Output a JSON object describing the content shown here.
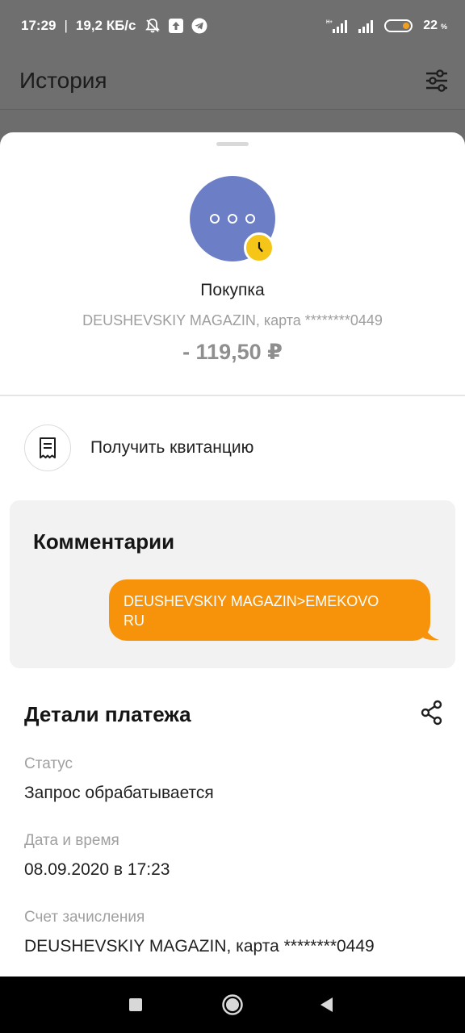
{
  "status_bar": {
    "time": "17:29",
    "separator": "|",
    "speed": "19,2 КБ/с",
    "battery_level": "22",
    "battery_unit": "%",
    "icons": [
      "bell-off-icon",
      "upload-icon",
      "telegram-icon",
      "signal-icon",
      "signal-icon",
      "battery-icon"
    ]
  },
  "header": {
    "title": "История",
    "filter_icon": "sliders-icon"
  },
  "transaction": {
    "avatar_icon": "more-dots-icon",
    "status_badge_icon": "clock-icon",
    "type": "Покупка",
    "merchant": "DEUSHEVSKIY MAGAZIN, карта ********0449",
    "amount": "- 119,50 ₽"
  },
  "receipt": {
    "icon": "receipt-icon",
    "label": "Получить квитанцию"
  },
  "comments": {
    "title": "Комментарии",
    "message_line1": "DEUSHEVSKIY MAGAZIN>EMEKOVO",
    "message_line2": "RU"
  },
  "details": {
    "title": "Детали платежа",
    "share_icon": "share-icon",
    "fields": [
      {
        "label": "Статус",
        "value": "Запрос обрабатывается"
      },
      {
        "label": "Дата и время",
        "value": "08.09.2020 в 17:23"
      },
      {
        "label": "Счет зачисления",
        "value": "DEUSHEVSKIY MAGAZIN, карта ********0449"
      }
    ]
  },
  "colors": {
    "accent_orange": "#f7930a",
    "avatar_blue": "#6c7fc6",
    "badge_yellow": "#f5c518"
  }
}
